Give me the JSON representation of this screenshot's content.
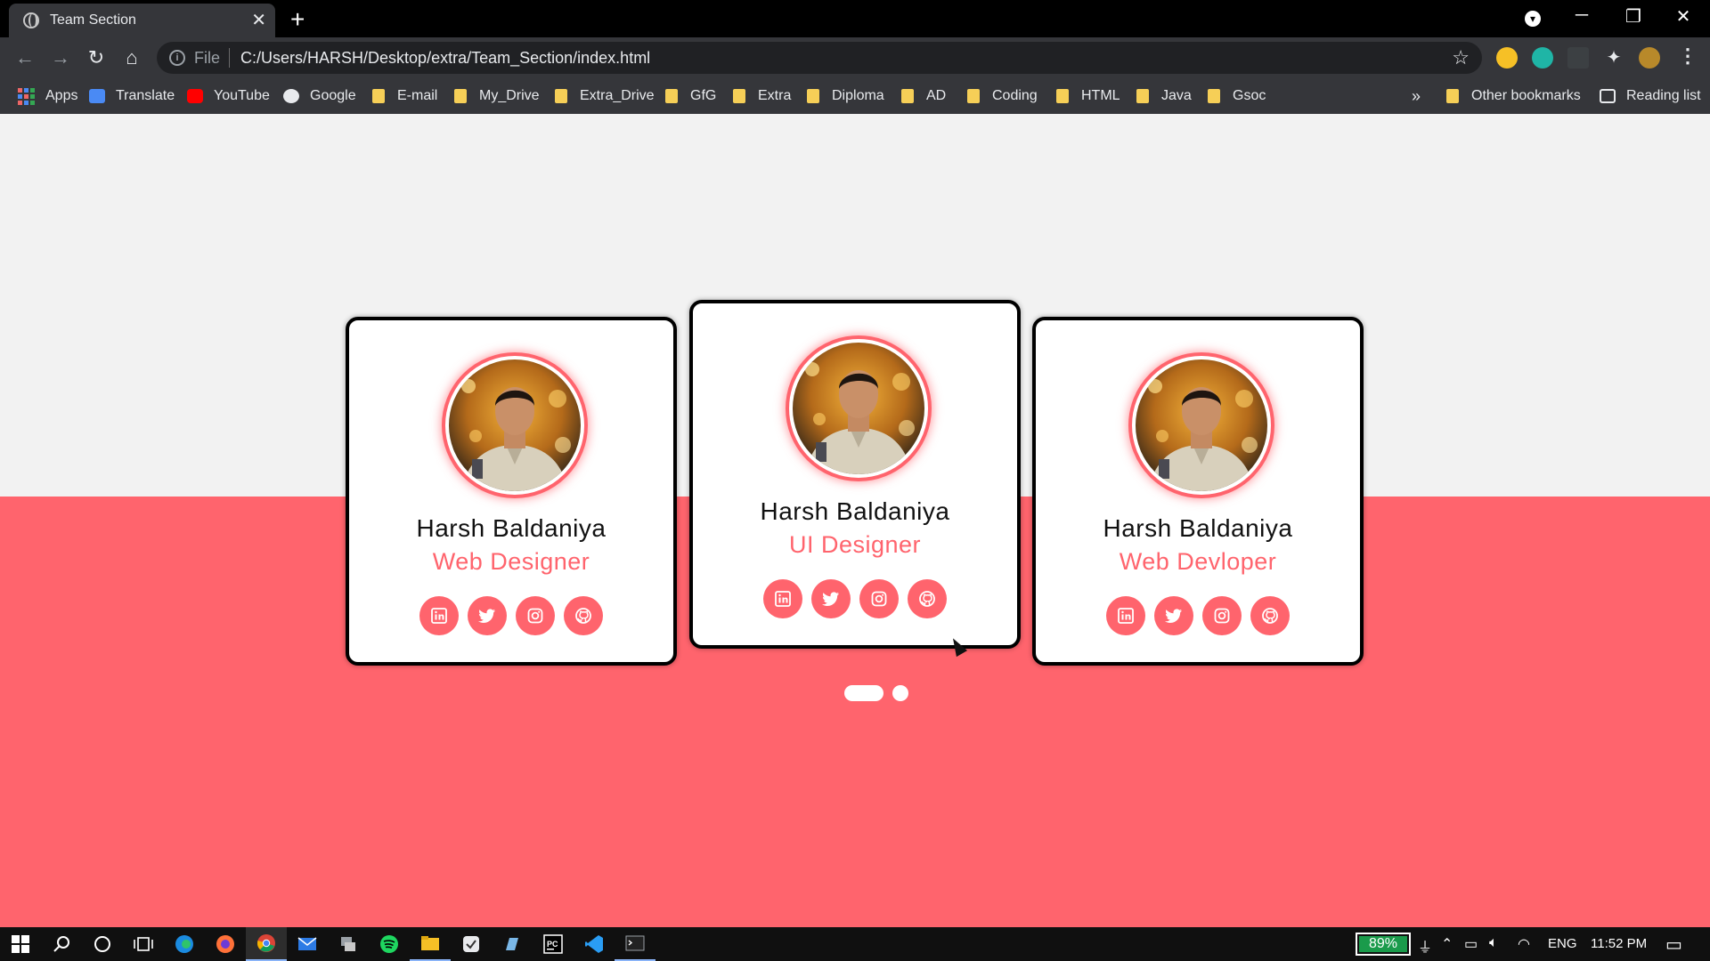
{
  "browser": {
    "tab_title": "Team Section",
    "tab_close": "✕",
    "new_tab": "+",
    "url_scheme": "File",
    "url": "C:/Users/HARSH/Desktop/extra/Team_Section/index.html",
    "window_controls": {
      "minimize": "─",
      "restore": "❐",
      "close": "✕"
    },
    "bookmarks": [
      {
        "label": "Apps",
        "icon": "apps-grid-icon"
      },
      {
        "label": "Translate",
        "icon": "translate-icon"
      },
      {
        "label": "YouTube",
        "icon": "youtube-icon"
      },
      {
        "label": "Google",
        "icon": "globe-icon"
      },
      {
        "label": "E-mail",
        "icon": "folder-icon"
      },
      {
        "label": "My_Drive",
        "icon": "folder-icon"
      },
      {
        "label": "Extra_Drive",
        "icon": "folder-icon"
      },
      {
        "label": "GfG",
        "icon": "folder-icon"
      },
      {
        "label": "Extra",
        "icon": "folder-icon"
      },
      {
        "label": "Diploma",
        "icon": "folder-icon"
      },
      {
        "label": "AD",
        "icon": "folder-icon"
      },
      {
        "label": "Coding",
        "icon": "folder-icon"
      },
      {
        "label": "HTML",
        "icon": "folder-icon"
      },
      {
        "label": "Java",
        "icon": "folder-icon"
      },
      {
        "label": "Gsoc",
        "icon": "folder-icon"
      }
    ],
    "more_bookmarks": "»",
    "other_bookmarks": "Other bookmarks",
    "reading_list": "Reading list"
  },
  "team": {
    "accent_color": "#ff646d",
    "members": [
      {
        "name": "Harsh Baldaniya",
        "role": "Web Designer"
      },
      {
        "name": "Harsh Baldaniya",
        "role": "UI Designer"
      },
      {
        "name": "Harsh Baldaniya",
        "role": "Web Devloper"
      }
    ],
    "social_icons": [
      "linkedin-icon",
      "twitter-icon",
      "instagram-icon",
      "github-icon"
    ],
    "pagination": {
      "active_index": 0,
      "count": 2
    }
  },
  "taskbar": {
    "battery": "89%",
    "language": "ENG",
    "time": "11:52 PM"
  }
}
